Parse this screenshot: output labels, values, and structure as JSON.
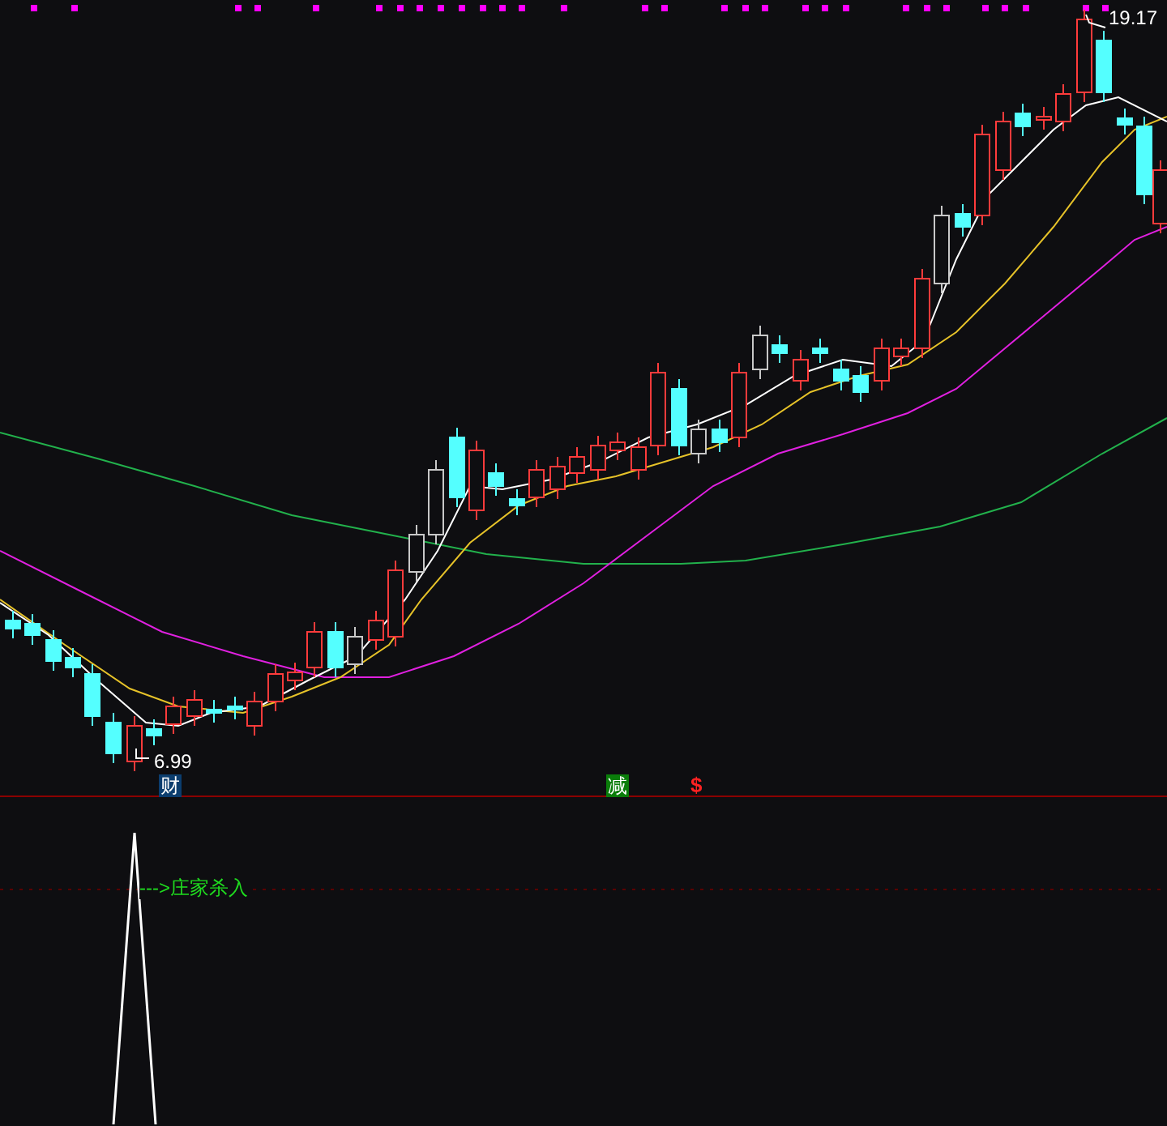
{
  "price_chart": {
    "high_label": "19.17",
    "low_label": "6.99",
    "signal_markers": [
      {
        "kind": "badge",
        "text": "财",
        "color": "#0b3d6e"
      },
      {
        "kind": "badge",
        "text": "减",
        "color": "#0a7d0a"
      },
      {
        "kind": "plain",
        "text": "$",
        "color": "#ff2222"
      }
    ]
  },
  "indicator_panel": {
    "signal_label": "--->庄家杀入"
  }
}
